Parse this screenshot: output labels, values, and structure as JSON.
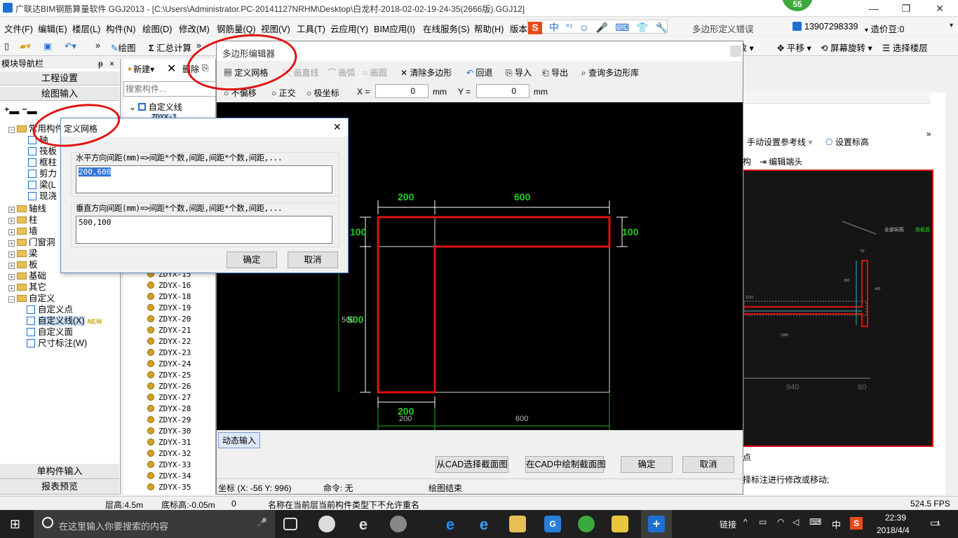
{
  "app": {
    "title": "广联达BIM钢筋算量软件 GGJ2013 - [C:\\Users\\Administrator.PC-20141127NRHM\\Desktop\\白龙村-2018-02-02-19-24-35(2666版).GGJ12]",
    "badge": "55",
    "min": "—",
    "max": "❐",
    "close": "✕"
  },
  "menu": [
    "文件(F)",
    "编辑(E)",
    "楼层(L)",
    "构件(N)",
    "绘图(D)",
    "修改(M)",
    "钢筋量(Q)",
    "视图(V)",
    "工具(T)",
    "云应用(Y)",
    "BIM应用(I)",
    "在线服务(S)",
    "帮助(H)",
    "版本"
  ],
  "menu_right": {
    "poly_error": "多边形定义错误",
    "phone": "13907298339",
    "price": "造价豆:0"
  },
  "toolbar": {
    "draw": "绘图",
    "calc": "汇总计算",
    "zoom": "缩放",
    "pan": "平移",
    "rotate": "屏幕旋转",
    "select_floor": "选择楼层"
  },
  "leftnav": {
    "title": "模块导航栏",
    "pin": "ᵽ",
    "close": "×",
    "project_settings": "工程设置",
    "drawing_input": "绘图输入",
    "tree": [
      {
        "label": "常用构件",
        "type": "folder",
        "level": 0,
        "expanded": true
      },
      {
        "label": "轴",
        "type": "item",
        "level": 2
      },
      {
        "label": "筏板",
        "type": "item",
        "level": 2
      },
      {
        "label": "框柱",
        "type": "item",
        "level": 2
      },
      {
        "label": "剪力",
        "type": "item",
        "level": 2
      },
      {
        "label": "梁(L",
        "type": "item",
        "level": 2
      },
      {
        "label": "现浇",
        "type": "item",
        "level": 2
      },
      {
        "label": "轴线",
        "type": "folder",
        "level": 0
      },
      {
        "label": "柱",
        "type": "folder",
        "level": 0
      },
      {
        "label": "墙",
        "type": "folder",
        "level": 0
      },
      {
        "label": "门窗洞",
        "type": "folder",
        "level": 0
      },
      {
        "label": "梁",
        "type": "folder",
        "level": 0
      },
      {
        "label": "板",
        "type": "folder",
        "level": 0
      },
      {
        "label": "基础",
        "type": "folder",
        "level": 0
      },
      {
        "label": "其它",
        "type": "folder",
        "level": 0
      },
      {
        "label": "自定义",
        "type": "folder",
        "level": 0,
        "expanded": true
      },
      {
        "label": "自定义点",
        "type": "item",
        "level": 1
      },
      {
        "label": "自定义线(X)",
        "type": "item",
        "level": 1,
        "selected": true
      },
      {
        "label": "自定义面",
        "type": "item",
        "level": 1
      },
      {
        "label": "尺寸标注(W)",
        "type": "item",
        "level": 1
      }
    ],
    "new_badge": "NEW",
    "single_input": "单构件输入",
    "report_preview": "报表预览"
  },
  "complist": {
    "new_btn": "新建",
    "delete_btn": "删除",
    "search_placeholder": "搜索构件...",
    "root": "自定义线",
    "first": "ZDYX-1",
    "items": [
      "ZDYX-15",
      "ZDYX-16",
      "ZDYX-18",
      "ZDYX-19",
      "ZDYX-20",
      "ZDYX-21",
      "ZDYX-22",
      "ZDYX-23",
      "ZDYX-24",
      "ZDYX-25",
      "ZDYX-26",
      "ZDYX-27",
      "ZDYX-28",
      "ZDYX-29",
      "ZDYX-30",
      "ZDYX-31",
      "ZDYX-32",
      "ZDYX-33",
      "ZDYX-34",
      "ZDYX-35"
    ]
  },
  "polyeditor": {
    "title": "多边形编辑器",
    "tools": {
      "define_grid": "定义网格",
      "draw_line": "画直线",
      "draw_arc": "画弧",
      "draw_circle": "画圆",
      "clear_polygon": "清除多边形",
      "undo": "回退",
      "import": "导入",
      "export": "导出",
      "query_lib": "查询多边形库"
    },
    "snap": {
      "no_offset": "不偏移",
      "orthogonal": "正交",
      "polar": "极坐标",
      "x_label": "X =",
      "x_value": "0",
      "y_label": "Y =",
      "y_value": "0",
      "unit": "mm"
    },
    "dims": {
      "top_left": "200",
      "top_right": "600",
      "left_top": "100",
      "right_top": "100",
      "left_bottom": "500",
      "left_bottom_grid": "500",
      "bottom_left": "200",
      "bottom_left_grid": "200",
      "bottom_right_grid": "600"
    },
    "dynamic_input": "动态输入",
    "btn_cad_select": "从CAD选择截面图",
    "btn_cad_draw": "在CAD中绘制截面图",
    "btn_ok": "确定",
    "btn_cancel": "取消",
    "coord": "坐标 (X: -56 Y: 996)",
    "command": "命令: 无",
    "draw_end": "绘图结束"
  },
  "griddlg": {
    "title": "定义网格",
    "close": "✕",
    "h_label": "水平方向间距(mm)=>间距*个数,间距,间距*个数,间距,...",
    "h_value": "200,600",
    "v_label": "垂直方向间距(mm)=>间距*个数,间距,间距*个数,间距,...",
    "v_value": "500,100",
    "ok": "确定",
    "cancel": "取消"
  },
  "rightpanel": {
    "manual_ref": "手动设置参考线",
    "set_elev": "设置标高",
    "struct": "构",
    "edit_end": "编辑端头",
    "label_all": "全部纵筋",
    "label_anchor": "按截面",
    "d1210": "1210",
    "d1000": "1000",
    "d940": "940",
    "d80": "80",
    "d390": "390",
    "d50": "50",
    "d400": "400",
    "hint_tail": "点",
    "hint": "择标注进行修改或移动;"
  },
  "statusbar": {
    "floor_height": "层高:4.5m",
    "base_height": "底标高:-0.05m",
    "zero": "0",
    "message": "名称在当前层当前构件类型下不允许重名",
    "fps": "524.5 FPS"
  },
  "taskbar": {
    "search_placeholder": "在这里输入你要搜索的内容",
    "link": "链接",
    "ime": "中",
    "time": "22:39",
    "date": "2018/4/4",
    "notif": "1"
  },
  "colors": {
    "accent": "#1d6fd1",
    "annotation": "#e01010",
    "dim_green": "#22d022",
    "canvas_bg": "#000000"
  }
}
